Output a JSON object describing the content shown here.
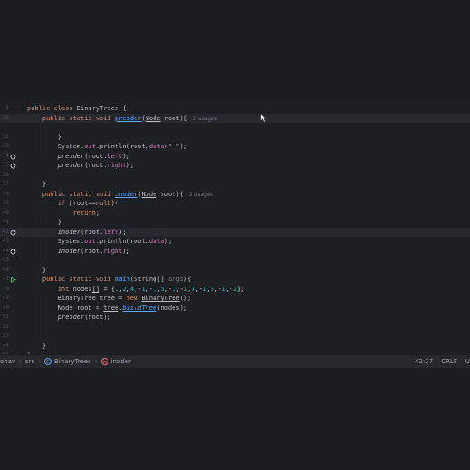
{
  "editor": {
    "lines": [
      {
        "n": "1",
        "html": "<span class='kw'>public class</span> BinaryTrees {"
      },
      {
        "n": "20",
        "html": "    <span class='kw'>public static void</span> <span class='fnu'>preoder</span>(<span class='clsu'>Node</span> root){<span class='hint'>3 usages</span>",
        "current": true
      },
      {
        "n": "",
        "html": ""
      },
      {
        "n": "32",
        "html": "        }"
      },
      {
        "n": "33",
        "html": "        System.<span class='fld it'>out</span>.println(root.<span class='fld'>data</span>+<span class='str'>\" \"</span>);"
      },
      {
        "n": "34",
        "html": "        <span class='it'>preoder</span>(root.<span class='fld'>left</span>);",
        "icon": "recursive-call-icon"
      },
      {
        "n": "35",
        "html": "        <span class='it'>preoder</span>(root.<span class='fld'>right</span>);",
        "icon": "recursive-call-icon"
      },
      {
        "n": "36",
        "html": ""
      },
      {
        "n": "37",
        "html": "    }"
      },
      {
        "n": "38",
        "html": "    <span class='kw'>public static void</span> <span class='fnu'>inoder</span>(<span class='clsu'>Node</span> root){<span class='hint'>2 usages</span>"
      },
      {
        "n": "39",
        "html": "        <span class='kw'>if</span> (root==<span class='kw'>null</span>){"
      },
      {
        "n": "40",
        "html": "            <span class='kw'>return</span>;"
      },
      {
        "n": "41",
        "html": "        }"
      },
      {
        "n": "42",
        "html": "        <span class='it'>inoder</span>(root.<span class='fld'>left</span>);",
        "icon": "recursive-call-icon",
        "current": true
      },
      {
        "n": "43",
        "html": "        System.<span class='fld it'>out</span>.println(root.<span class='fld'>data</span>);"
      },
      {
        "n": "44",
        "html": "        <span class='it'>inoder</span>(root.<span class='fld'>right</span>);",
        "icon": "recursive-call-icon"
      },
      {
        "n": "45",
        "html": ""
      },
      {
        "n": "46",
        "html": "    }"
      },
      {
        "n": "47",
        "html": "    <span class='kw'>public static void</span> <span class='fn'>main</span>(String[] <span class='prm'>args</span>){",
        "icon": "run-icon"
      },
      {
        "n": "48",
        "html": "        <span class='kw'>int</span> nodes<span class='clsu'>[]</span> = {<span class='num'>1</span>,<span class='num'>2</span>,<span class='num'>4</span>,-<span class='num'>1</span>,-<span class='num'>1</span>,<span class='num'>5</span>,-<span class='num'>1</span>,-<span class='num'>1</span>,<span class='num'>3</span>,-<span class='num'>1</span>,<span class='num'>6</span>,-<span class='num'>1</span>,-<span class='num'>1</span>};"
      },
      {
        "n": "49",
        "html": "        BinaryTree tree = <span class='kw'>new</span> <span class='clsu'>BinaryTree</span>();"
      },
      {
        "n": "50",
        "html": "        Node root = <span class='clsu'>tree</span>.<span class='fnu it'>buildTree</span>(nodes);"
      },
      {
        "n": "51",
        "html": "        <span class='it'>preoder</span>(root);"
      },
      {
        "n": "52",
        "html": ""
      },
      {
        "n": "53",
        "html": ""
      },
      {
        "n": "54",
        "html": "    }"
      },
      {
        "n": "55",
        "html": "}"
      }
    ]
  },
  "statusbar": {
    "crumbs": [
      {
        "label": "ohav"
      },
      {
        "label": "src"
      },
      {
        "label": "BinaryTrees",
        "icon": "class-icon"
      },
      {
        "label": "inoder",
        "icon": "method-icon"
      }
    ],
    "position": "42:27",
    "line_ending": "CRLF",
    "encoding": "U"
  }
}
